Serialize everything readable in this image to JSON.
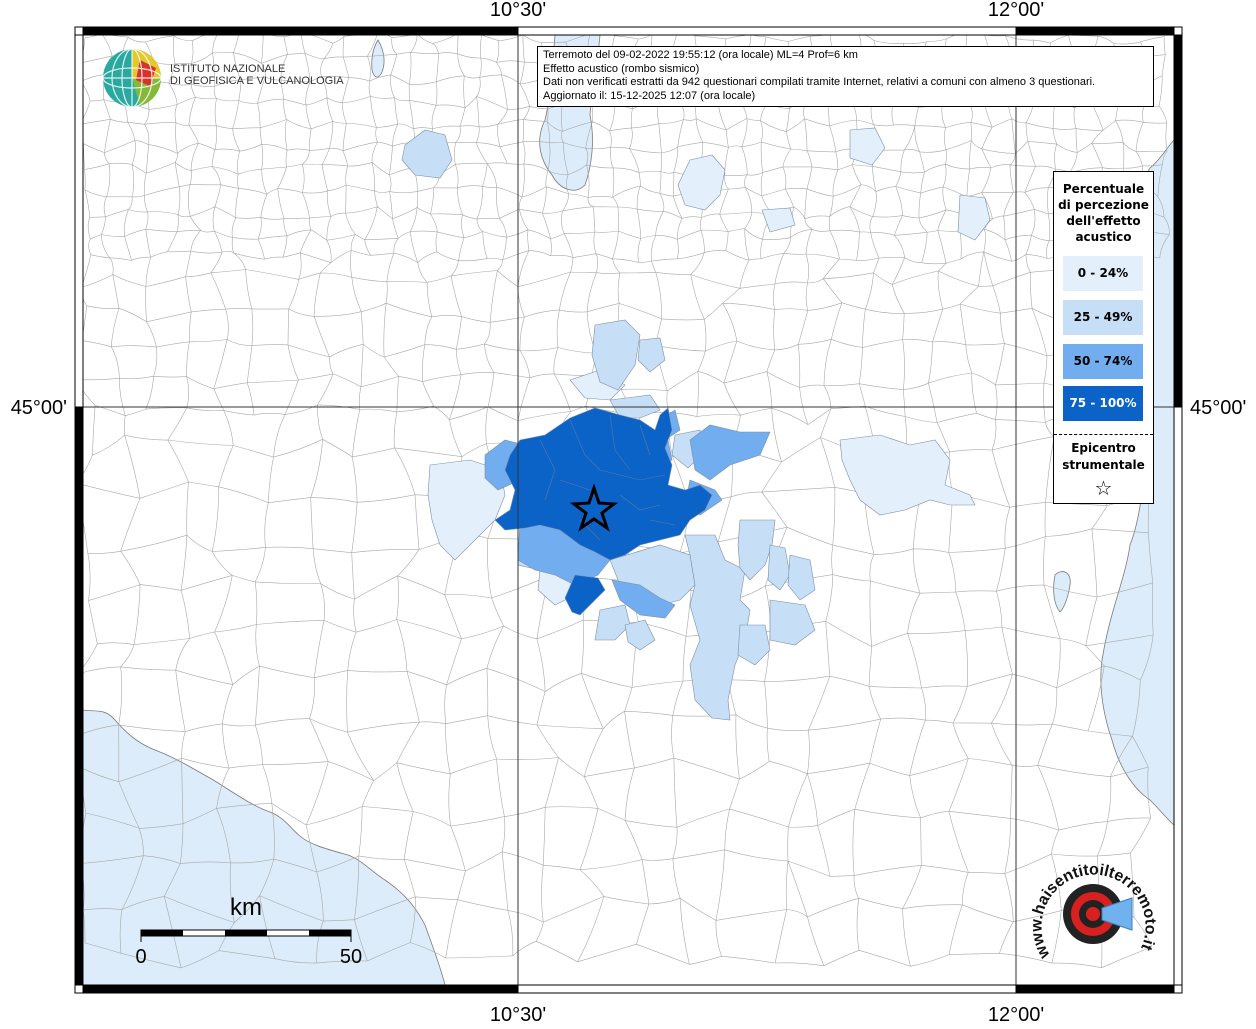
{
  "header": {
    "line1": "Terremoto del 09-02-2022 19:55:12 (ora locale) ML=4 Prof=6 km",
    "line2": "Effetto acustico (rombo sismico)",
    "line3": "Dati non verificati estratti da 942 questionari compilati tramite Internet, relativi a comuni con almeno 3 questionari.",
    "line4": "Aggiornato il: 15-12-2025 12:07 (ora locale)"
  },
  "logo": {
    "line1": "ISTITUTO NAZIONALE",
    "line2": "DI GEOFISICA E VULCANOLOGIA",
    "icon": "globe-logo-icon"
  },
  "axes": {
    "lon_ticks": [
      "10°30'",
      "12°00'"
    ],
    "lat_ticks": [
      "45°00'"
    ]
  },
  "legend": {
    "title_lines": [
      "Percentuale",
      "di percezione",
      "dell'effetto",
      "acustico"
    ],
    "classes": [
      {
        "label": "0 - 24%",
        "color": "#e3f0fb"
      },
      {
        "label": "25 - 49%",
        "color": "#c7dff6"
      },
      {
        "label": "50 - 74%",
        "color": "#72adf0"
      },
      {
        "label": "75 - 100%",
        "color": "#0b63c8"
      }
    ],
    "epicenter_line1": "Epicentro",
    "epicenter_line2": "strumentale",
    "epicenter_symbol": "☆"
  },
  "scale": {
    "unit": "km",
    "min_label": "0",
    "max_label": "50"
  },
  "badge": {
    "text": "www.haisentitoilterremoto.it",
    "icon": "megaphone-target-icon"
  },
  "colors": {
    "sea": "#dcecfa",
    "land": "#ffffff",
    "boundary": "#9a9a9a"
  }
}
